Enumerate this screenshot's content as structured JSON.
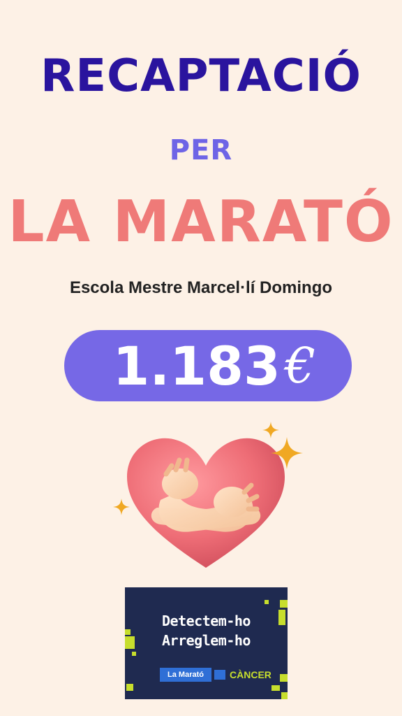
{
  "poster": {
    "title_line1": "RECAPTACIÓ",
    "title_line2": "PER",
    "title_line3": "LA MARATÓ",
    "school": "Escola Mestre Marcel·lí Domingo",
    "amount": "1.183",
    "currency": "€"
  },
  "logo": {
    "line1": "Detectem-ho",
    "line2": "Arreglem-ho",
    "org": "La Marató",
    "cause": "CÀNCER"
  },
  "colors": {
    "background": "#fdf1e6",
    "title_primary": "#2a149e",
    "title_secondary": "#6e64e6",
    "title_accent": "#ef7a78",
    "amount_pill": "#7668e6",
    "logo_background": "#1f2a50",
    "logo_accent": "#c7de2d"
  },
  "icons": [
    "heart-hug-icon",
    "sparkle-icon"
  ]
}
